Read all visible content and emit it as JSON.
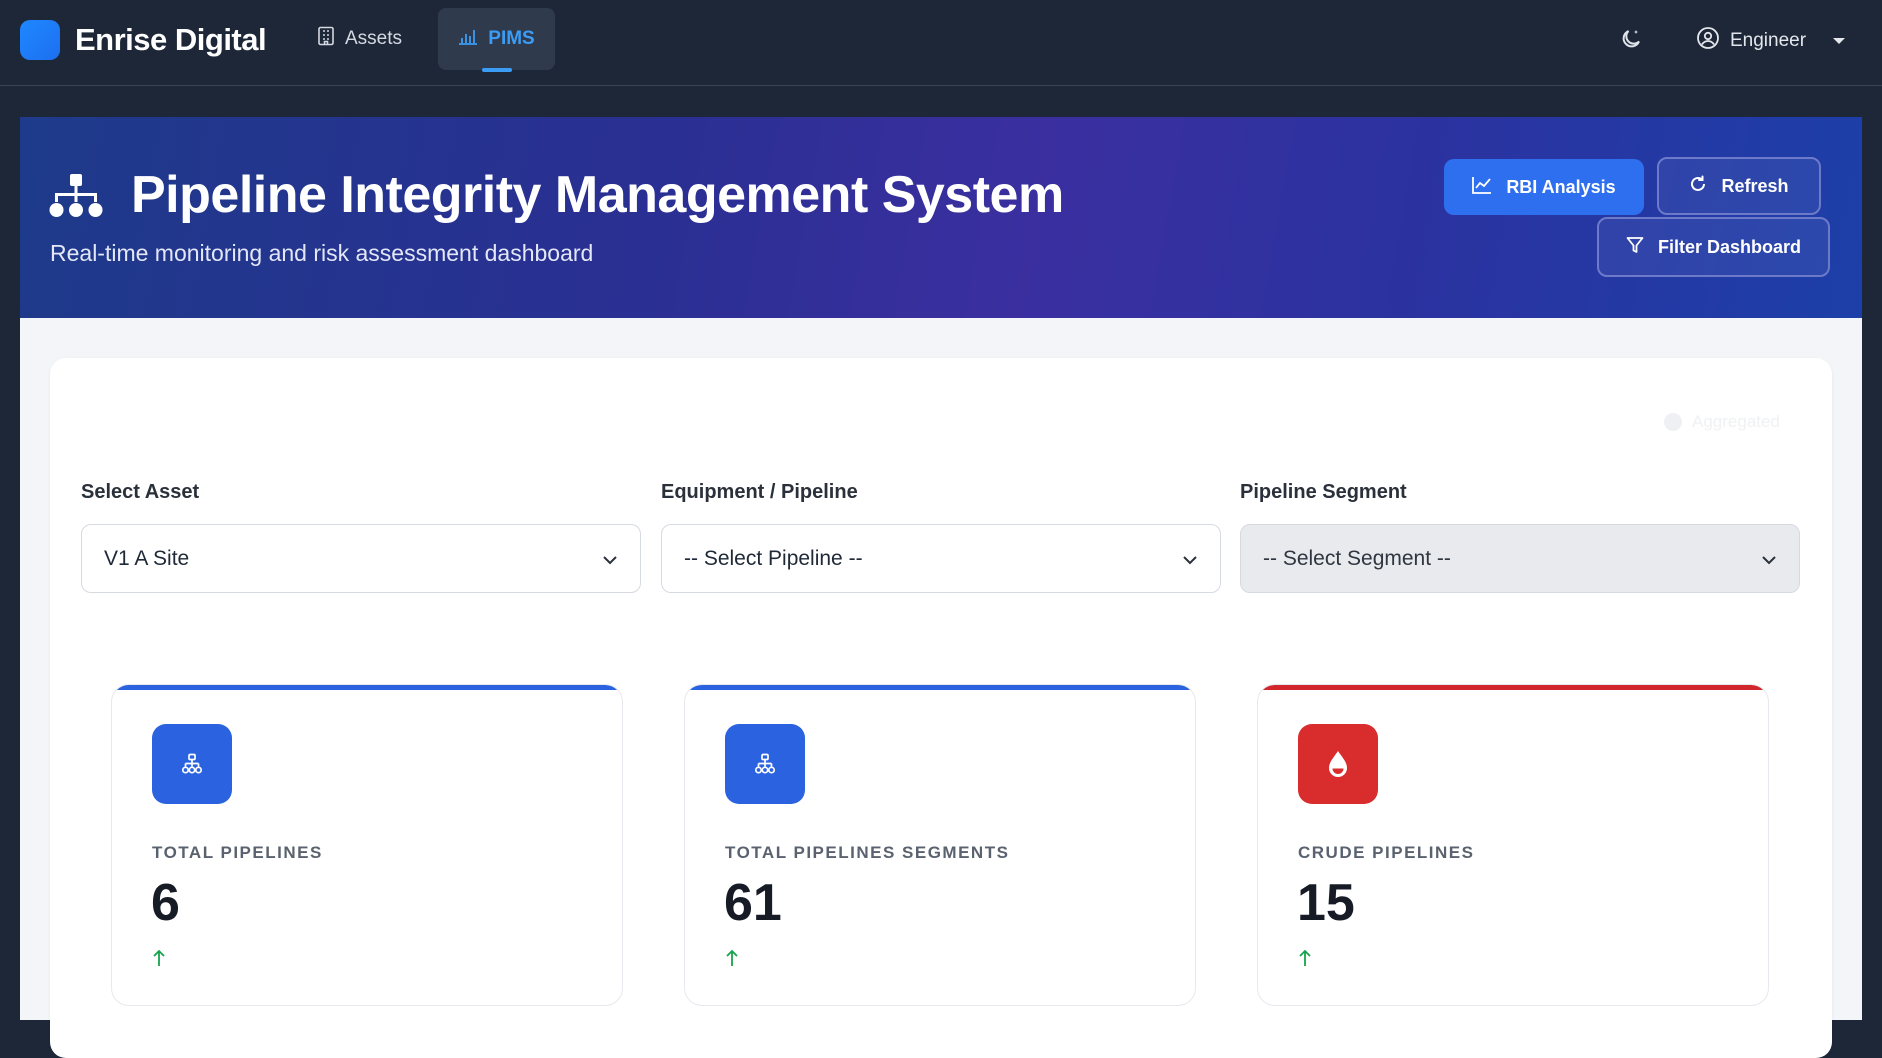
{
  "nav": {
    "brand": "Enrise Digital",
    "items": [
      {
        "label": "Assets",
        "icon": "building-icon"
      },
      {
        "label": "PIMS",
        "icon": "bar-chart-icon",
        "active": true
      }
    ],
    "user": "Engineer"
  },
  "hero": {
    "title": "Pipeline Integrity Management System",
    "subtitle": "Real-time monitoring and risk assessment dashboard",
    "buttons": {
      "rbi": "RBI Analysis",
      "refresh": "Refresh",
      "filter": "Filter Dashboard"
    }
  },
  "filters": {
    "aggregated": "Aggregated",
    "asset": {
      "label": "Select Asset",
      "value": "V1 A Site"
    },
    "pipeline": {
      "label": "Equipment / Pipeline",
      "value": "-- Select Pipeline --"
    },
    "segment": {
      "label": "Pipeline Segment",
      "value": "-- Select Segment --",
      "disabled": true
    }
  },
  "stats": [
    {
      "label": "TOTAL PIPELINES",
      "value": "6",
      "accent": "#2b62e0",
      "icon": "sitemap-icon"
    },
    {
      "label": "TOTAL PIPELINES SEGMENTS",
      "value": "61",
      "accent": "#2b62e0",
      "icon": "sitemap-icon"
    },
    {
      "label": "CRUDE PIPELINES",
      "value": "15",
      "accent": "#d0262c",
      "icon": "droplet-icon"
    }
  ],
  "colors": {
    "nav_bg": "#1e2738",
    "accent": "#3b9cf5",
    "trend_up": "#16a34a"
  }
}
